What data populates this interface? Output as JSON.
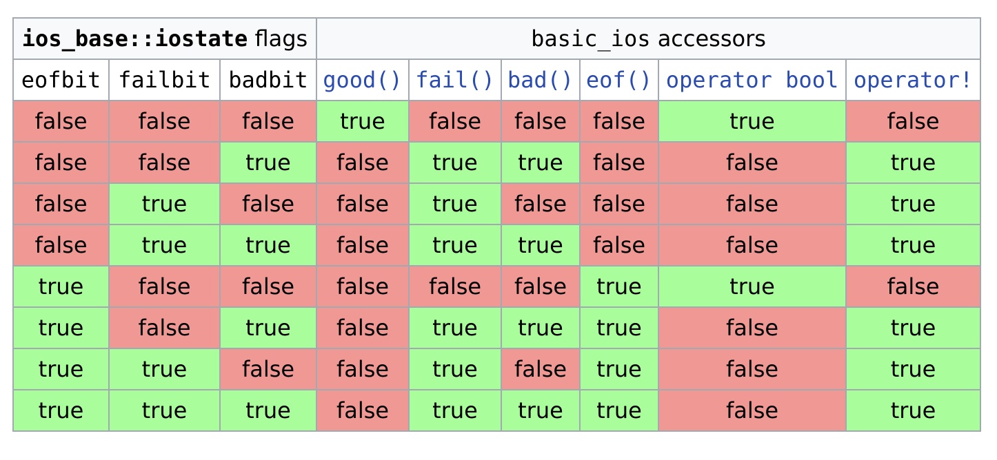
{
  "header": {
    "flags_group_code": "ios_base::iostate",
    "flags_group_suffix": " flags",
    "accessors_group_code": "basic_ios",
    "accessors_group_suffix": " accessors"
  },
  "columns": [
    {
      "label": "eofbit",
      "link": false
    },
    {
      "label": "failbit",
      "link": false
    },
    {
      "label": "badbit",
      "link": false
    },
    {
      "label": "good()",
      "link": true
    },
    {
      "label": "fail()",
      "link": true
    },
    {
      "label": "bad()",
      "link": true
    },
    {
      "label": "eof()",
      "link": true
    },
    {
      "label": "operator bool",
      "link": true
    },
    {
      "label": "operator!",
      "link": true
    }
  ],
  "rows": [
    [
      "false",
      "false",
      "false",
      "true",
      "false",
      "false",
      "false",
      "true",
      "false"
    ],
    [
      "false",
      "false",
      "true",
      "false",
      "true",
      "true",
      "false",
      "false",
      "true"
    ],
    [
      "false",
      "true",
      "false",
      "false",
      "true",
      "false",
      "false",
      "false",
      "true"
    ],
    [
      "false",
      "true",
      "true",
      "false",
      "true",
      "true",
      "false",
      "false",
      "true"
    ],
    [
      "true",
      "false",
      "false",
      "false",
      "false",
      "false",
      "true",
      "true",
      "false"
    ],
    [
      "true",
      "false",
      "true",
      "false",
      "true",
      "true",
      "true",
      "false",
      "true"
    ],
    [
      "true",
      "true",
      "false",
      "false",
      "true",
      "false",
      "true",
      "false",
      "true"
    ],
    [
      "true",
      "true",
      "true",
      "false",
      "true",
      "true",
      "true",
      "false",
      "true"
    ]
  ],
  "colors": {
    "true_cell": "#a9fd9b",
    "false_cell": "#ef9894",
    "link": "#2a4bb0",
    "border": "#a2a9b1",
    "group_header_bg": "#f8f9fa"
  }
}
